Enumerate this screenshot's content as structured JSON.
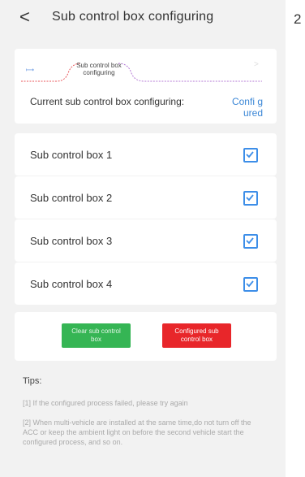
{
  "header": {
    "back_glyph": "<",
    "title": "Sub control box configuring"
  },
  "side_label": "2",
  "progress": {
    "start_glyph": "⟼",
    "step_label": "Sub control box configuring",
    "end_glyph": ">"
  },
  "status": {
    "label": "Current sub control box configuring:",
    "value": "Confi gured"
  },
  "boxes": [
    {
      "label": "Sub control box 1",
      "checked": true
    },
    {
      "label": "Sub control box 2",
      "checked": true
    },
    {
      "label": "Sub control box 3",
      "checked": true
    },
    {
      "label": "Sub control box 4",
      "checked": true
    }
  ],
  "actions": {
    "clear_label": "Clear sub control box",
    "configured_label": "Configured sub control box"
  },
  "tips": {
    "title": "Tips:",
    "items": [
      "[1] If the configured process failed, please try again",
      "[2] When multi-vehicle are installed at the same time,do not turn off the ACC or keep the ambient light on before the second vehicle start the configured process, and so on."
    ]
  },
  "colors": {
    "checkbox": "#3d8ee8",
    "clear_button": "#35b554",
    "configured_button": "#e8262a",
    "status_value": "#3a86d6",
    "progress_red": "#e8565a",
    "progress_purple": "#b57ad6"
  }
}
